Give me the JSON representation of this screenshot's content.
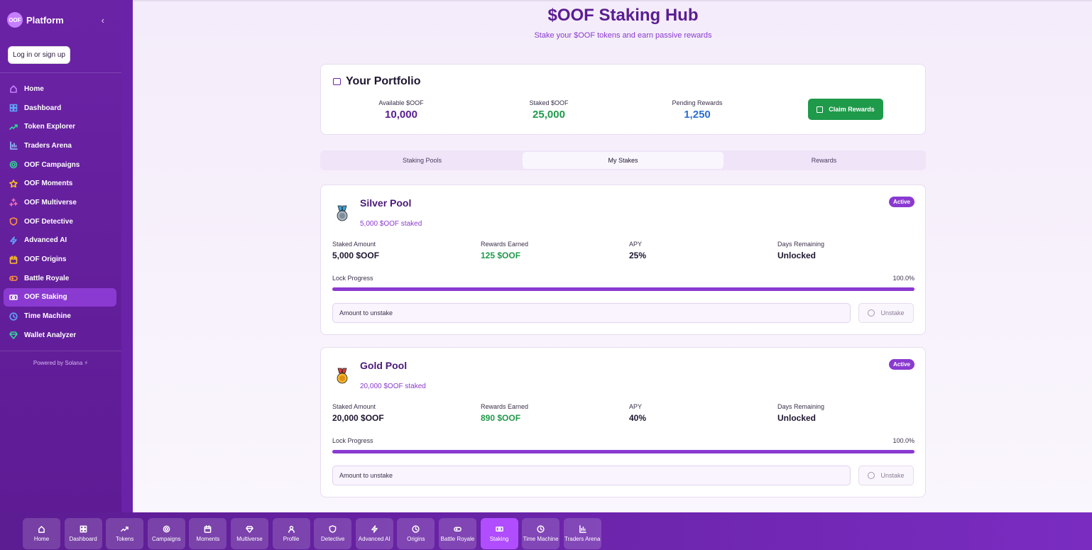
{
  "sidebar": {
    "logo_text": "OOF",
    "brand": "Platform",
    "collapse_glyph": "‹",
    "login_label": "Log in or sign up",
    "items": [
      {
        "label": "Home",
        "icon": "home-icon",
        "color": "#c77dff"
      },
      {
        "label": "Dashboard",
        "icon": "dashboard-icon",
        "color": "#60a5fa"
      },
      {
        "label": "Token Explorer",
        "icon": "trending-icon",
        "color": "#34d399"
      },
      {
        "label": "Traders Arena",
        "icon": "bar-chart-icon",
        "color": "#93c5fd"
      },
      {
        "label": "OOF Campaigns",
        "icon": "target-icon",
        "color": "#34d399"
      },
      {
        "label": "OOF Moments",
        "icon": "star-icon",
        "color": "#fbbf24"
      },
      {
        "label": "OOF Multiverse",
        "icon": "sparkles-icon",
        "color": "#f472b6"
      },
      {
        "label": "OOF Detective",
        "icon": "shield-icon",
        "color": "#fb923c"
      },
      {
        "label": "Advanced AI",
        "icon": "zap-icon",
        "color": "#60a5fa"
      },
      {
        "label": "OOF Origins",
        "icon": "calendar-icon",
        "color": "#fbbf24"
      },
      {
        "label": "Battle Royale",
        "icon": "gamepad-icon",
        "color": "#fb923c"
      },
      {
        "label": "OOF Staking",
        "icon": "coins-icon",
        "color": "#ffffff"
      },
      {
        "label": "Time Machine",
        "icon": "clock-icon",
        "color": "#60a5fa"
      },
      {
        "label": "Wallet Analyzer",
        "icon": "gem-icon",
        "color": "#34d399"
      }
    ],
    "active_index": 11,
    "powered_by": "Powered by Solana ⚡"
  },
  "header": {
    "title": "$OOF Staking Hub",
    "subtitle": "Stake your $OOF tokens and earn passive rewards"
  },
  "portfolio": {
    "title": "Your Portfolio",
    "available_label": "Available $OOF",
    "available_value": "10,000",
    "staked_label": "Staked $OOF",
    "staked_value": "25,000",
    "pending_label": "Pending Rewards",
    "pending_value": "1,250",
    "claim_label": "Claim Rewards"
  },
  "tabs": [
    {
      "label": "Staking Pools"
    },
    {
      "label": "My Stakes"
    },
    {
      "label": "Rewards"
    }
  ],
  "active_tab": 1,
  "stakes": [
    {
      "name": "Silver Pool",
      "staked_summary": "5,000 $OOF staked",
      "status": "Active",
      "staked_amount_label": "Staked Amount",
      "staked_amount": "5,000 $OOF",
      "rewards_label": "Rewards Earned",
      "rewards": "125 $OOF",
      "apy_label": "APY",
      "apy": "25%",
      "days_label": "Days Remaining",
      "days": "Unlocked",
      "lock_label": "Lock Progress",
      "lock_pct_text": "100.0%",
      "lock_fraction": 1.0,
      "input_placeholder": "Amount to unstake",
      "unstake_label": "Unstake"
    },
    {
      "name": "Gold Pool",
      "staked_summary": "20,000 $OOF staked",
      "status": "Active",
      "staked_amount_label": "Staked Amount",
      "staked_amount": "20,000 $OOF",
      "rewards_label": "Rewards Earned",
      "rewards": "890 $OOF",
      "apy_label": "APY",
      "apy": "40%",
      "days_label": "Days Remaining",
      "days": "Unlocked",
      "lock_label": "Lock Progress",
      "lock_pct_text": "100.0%",
      "lock_fraction": 1.0,
      "input_placeholder": "Amount to unstake",
      "unstake_label": "Unstake"
    }
  ],
  "bottom_nav": [
    {
      "label": "Home",
      "icon": "home-icon"
    },
    {
      "label": "Dashboard",
      "icon": "dashboard-icon"
    },
    {
      "label": "Tokens",
      "icon": "trending-icon"
    },
    {
      "label": "Campaigns",
      "icon": "target-icon"
    },
    {
      "label": "Moments",
      "icon": "calendar-icon"
    },
    {
      "label": "Multiverse",
      "icon": "gem-icon"
    },
    {
      "label": "Profile",
      "icon": "user-icon"
    },
    {
      "label": "Detective",
      "icon": "shield-icon"
    },
    {
      "label": "Advanced AI",
      "icon": "zap-icon"
    },
    {
      "label": "Origins",
      "icon": "clock-icon"
    },
    {
      "label": "Battle Royale",
      "icon": "gamepad-icon"
    },
    {
      "label": "Staking",
      "icon": "coins-icon"
    },
    {
      "label": "Time Machine",
      "icon": "clock-icon"
    },
    {
      "label": "Traders Arena",
      "icon": "bar-chart-icon"
    }
  ],
  "bottom_active_index": 11,
  "colors": {
    "available": "#5a1d92",
    "staked": "#1f9a4a",
    "pending": "#2a6fd0",
    "rewards": "#1f9a4a",
    "accent": "#8a3ad0"
  }
}
